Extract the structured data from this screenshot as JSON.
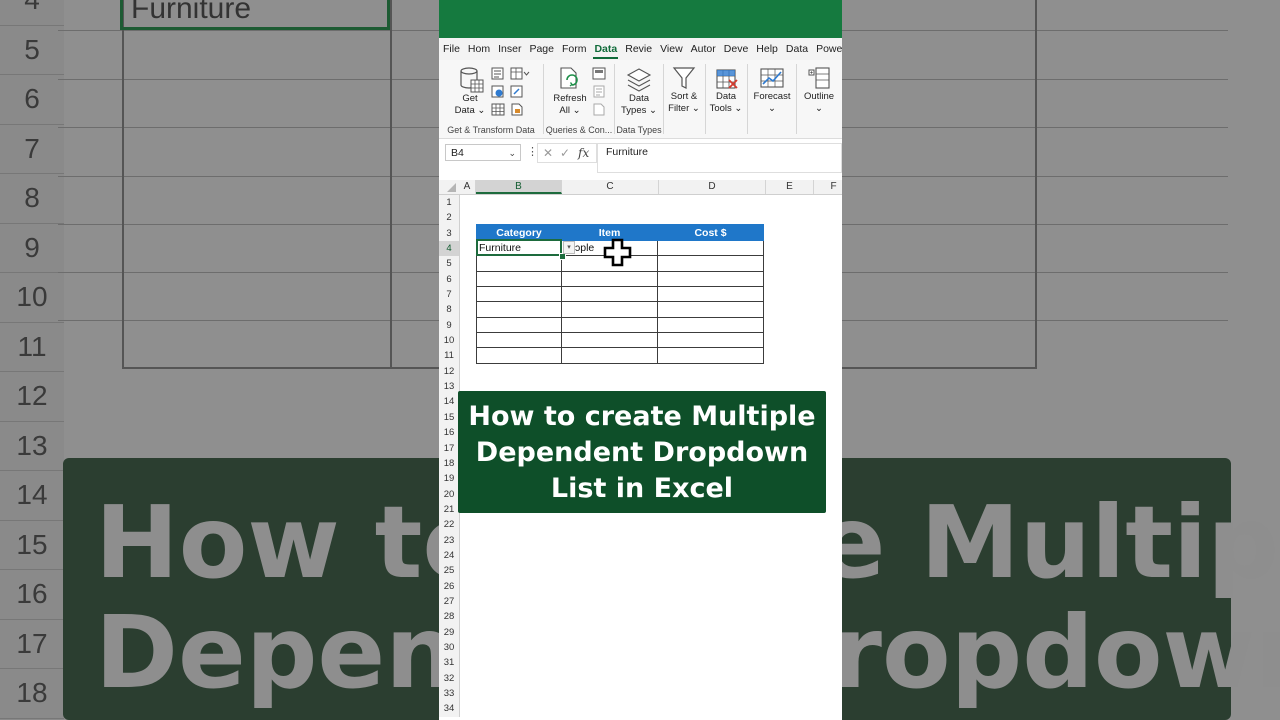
{
  "background": {
    "row_numbers": [
      "4",
      "5",
      "6",
      "7",
      "8",
      "9",
      "10",
      "11",
      "12",
      "13",
      "14",
      "15",
      "16",
      "17",
      "18"
    ],
    "cell_value": "Furniture",
    "banner_lines": [
      "How to create Multiple",
      "Dependent Dropdown"
    ]
  },
  "ribbon": {
    "tabs": [
      "File",
      "Hom",
      "Inser",
      "Page",
      "Form",
      "Data",
      "Revie",
      "View",
      "Autor",
      "Deve",
      "Help",
      "Data",
      "Powe"
    ],
    "active_tab": "Data",
    "groups": {
      "get_transform": {
        "get_data_label": [
          "Get",
          "Data ⌄"
        ],
        "label": "Get & Transform Data"
      },
      "queries": {
        "refresh_label": [
          "Refresh",
          "All ⌄"
        ],
        "label": "Queries & Con..."
      },
      "data_types": {
        "button_label": [
          "Data",
          "Types ⌄"
        ],
        "label": "Data Types"
      },
      "sort_filter": {
        "button_label": [
          "Sort &",
          "Filter ⌄"
        ]
      },
      "data_tools": {
        "button_label": [
          "Data",
          "Tools ⌄"
        ]
      },
      "forecast": {
        "button_label": [
          "Forecast",
          "⌄"
        ]
      },
      "outline": {
        "button_label": [
          "Outline",
          "⌄"
        ]
      }
    }
  },
  "formula_bar": {
    "name_box": "B4",
    "dots": "⋮",
    "cancel_glyph": "✕",
    "enter_glyph": "✓",
    "fx_glyph": "fx",
    "value": "Furniture"
  },
  "sheet": {
    "columns": [
      "A",
      "B",
      "C",
      "D",
      "E",
      "F"
    ],
    "selected_column": "B",
    "rows": [
      "1",
      "2",
      "3",
      "4",
      "5",
      "6",
      "7",
      "8",
      "9",
      "10",
      "11",
      "12",
      "13",
      "14",
      "15",
      "16",
      "17",
      "18",
      "19",
      "20",
      "21",
      "22",
      "23",
      "24",
      "25",
      "26",
      "27",
      "28",
      "29",
      "30",
      "31",
      "32",
      "33",
      "34"
    ],
    "selected_row": "4",
    "table": {
      "headers": [
        "Category",
        "Item",
        "Cost $"
      ],
      "row1": [
        "Furniture",
        "ɔple",
        ""
      ],
      "empty_rows": 7
    },
    "dropdown_glyph": "▾"
  },
  "overlay": {
    "banner_lines": [
      "How to create Multiple",
      "Dependent Dropdown",
      "List in Excel"
    ],
    "colors": {
      "banner": "#0e4f29",
      "header": "#1f77c9",
      "accent": "#157a3f"
    }
  }
}
